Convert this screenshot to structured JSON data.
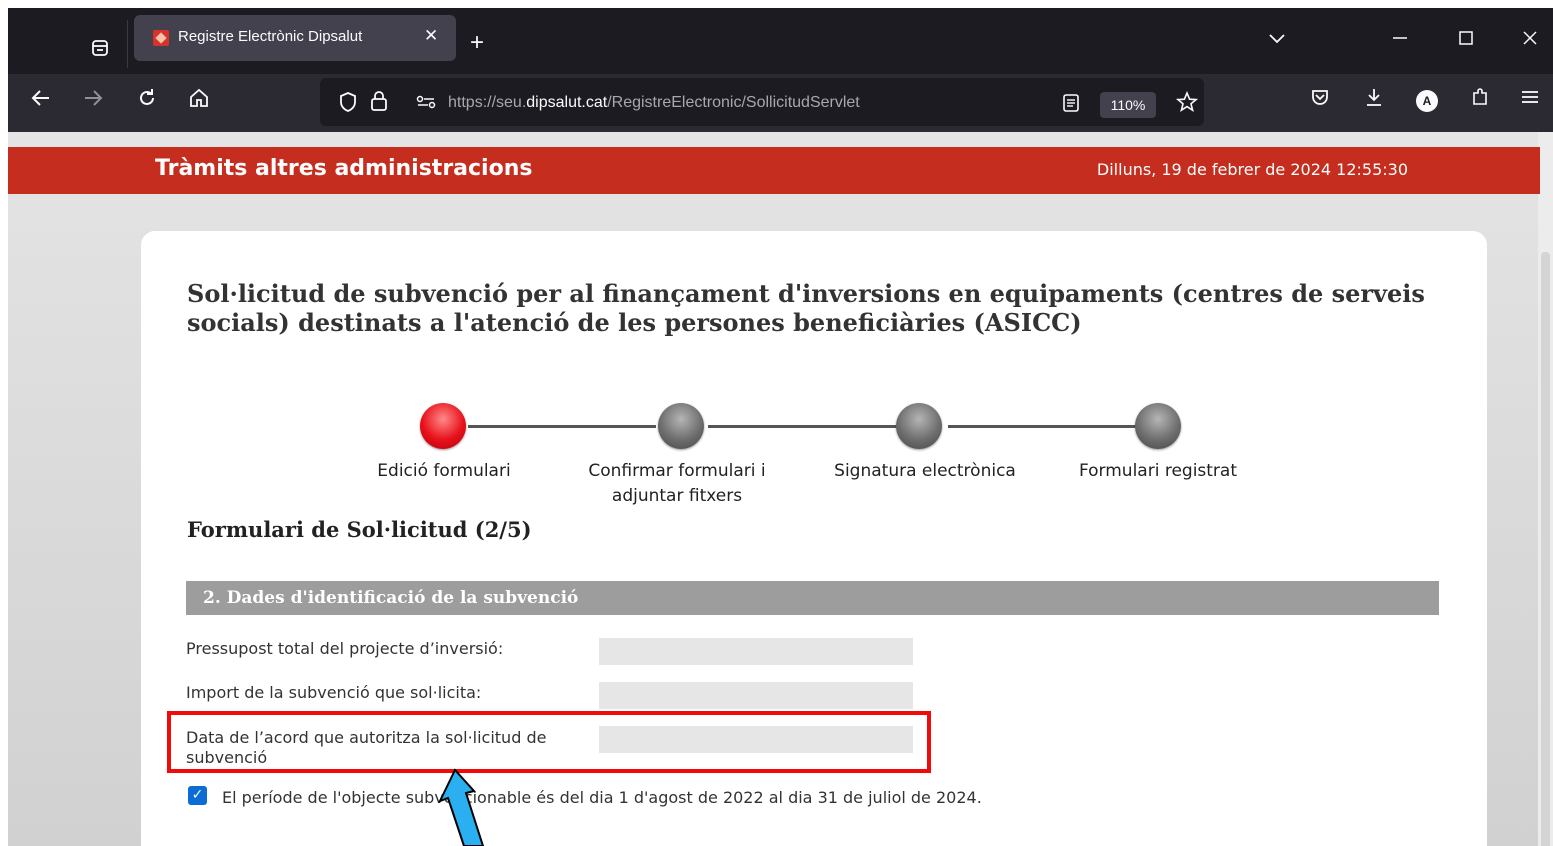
{
  "browser": {
    "tab_title": "Registre Electrònic Dipsalut",
    "tab_close": "✕",
    "new_tab": "+",
    "url_scheme": "https://seu.",
    "url_host": "dipsalut.cat",
    "url_path": "/RegistreElectronic/SollicitudServlet",
    "zoom": "110%",
    "profile_initial": "A"
  },
  "header": {
    "title": "Tràmits altres administracions",
    "datetime": "Dilluns, 19 de febrer de 2024 12:55:30"
  },
  "form": {
    "title": "Sol·licitud de subvenció per al finançament d'inversions en equipaments (centres de serveis socials) destinats a l'atenció de les persones beneficiàries (ASICC)",
    "steps": [
      {
        "label": "Edició formulari",
        "status": "active"
      },
      {
        "label": "Confirmar formulari i adjuntar fitxers",
        "status": "pending"
      },
      {
        "label": "Signatura electrònica",
        "status": "pending"
      },
      {
        "label": "Formulari registrat",
        "status": "pending"
      }
    ],
    "subtitle": "Formulari de Sol·licitud (2/5)",
    "section_title": "2. Dades d'identificació de la subvenció",
    "fields": [
      {
        "label": "Pressupost total del projecte d’inversió:",
        "value": ""
      },
      {
        "label": "Import de la subvenció que sol·licita:",
        "value": ""
      },
      {
        "label": "Data de l’acord que autoritza la sol·licitud de subvenció",
        "value": ""
      }
    ],
    "checkbox_text": "El període de l'objecte subvencionable és del dia 1 d'agost de 2022 al dia 31 de juliol de 2024.",
    "checkbox_checked": true
  },
  "colors": {
    "header_red": "#c52d1f",
    "highlight_red": "#f00a0a",
    "arrow_blue": "#2ab0f0"
  }
}
